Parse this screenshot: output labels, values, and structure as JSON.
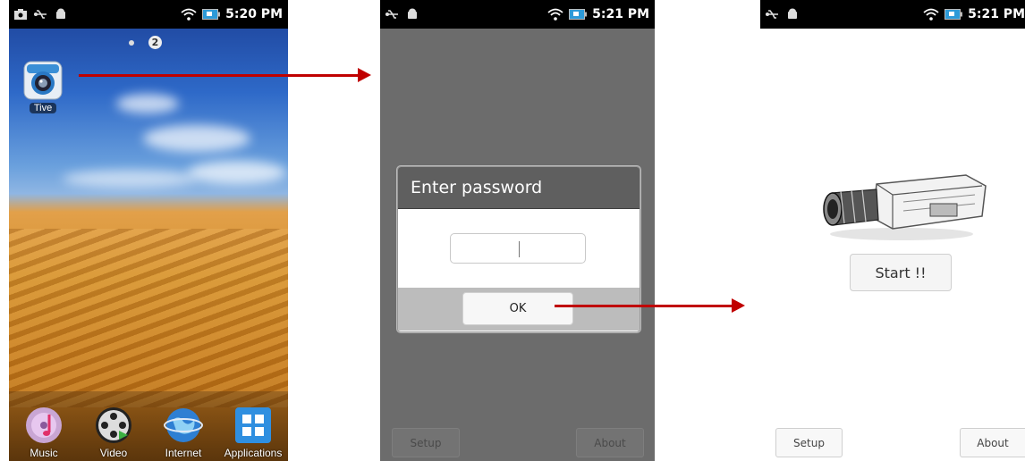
{
  "phone1": {
    "status_time": "5:20 PM",
    "page_indicator_number": "2",
    "app_icon_label": "Tive",
    "dock": [
      {
        "label": "Music",
        "icon": "music-icon"
      },
      {
        "label": "Video",
        "icon": "video-icon"
      },
      {
        "label": "Internet",
        "icon": "globe-icon"
      },
      {
        "label": "Applications",
        "icon": "grid-icon"
      }
    ]
  },
  "phone2": {
    "status_time": "5:21 PM",
    "dialog_title": "Enter password",
    "password_value": "",
    "ok_label": "OK",
    "setup_label": "Setup",
    "about_label": "About"
  },
  "phone3": {
    "status_time": "5:21 PM",
    "start_label": "Start !!",
    "setup_label": "Setup",
    "about_label": "About"
  },
  "colors": {
    "arrow": "#c00000",
    "status_bar": "#000000",
    "dim_overlay": "#6c6c6c",
    "dialog_title_bg": "#5f5f5f"
  }
}
